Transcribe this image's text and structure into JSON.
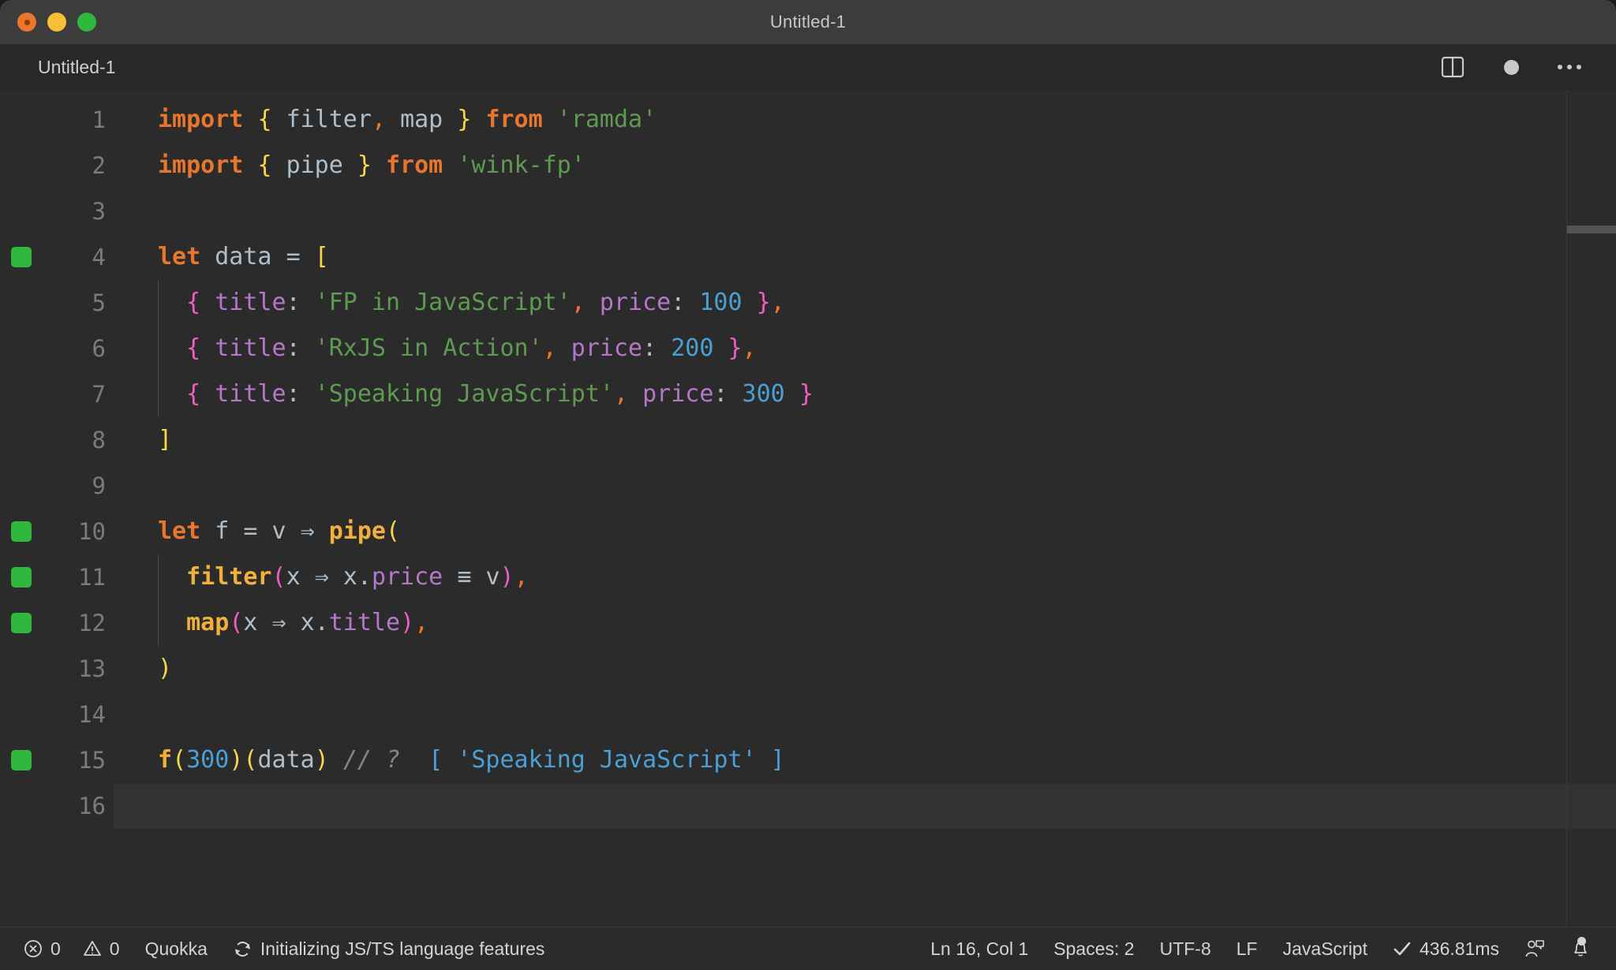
{
  "window": {
    "title": "Untitled-1",
    "traffic_lights": [
      "close-button",
      "minimize-button",
      "maximize-button"
    ]
  },
  "tab": {
    "label": "Untitled-1"
  },
  "editor_actions": {
    "split_editor": "split-editor-icon",
    "unsaved_dot": "unsaved-indicator",
    "more": "more-actions-icon"
  },
  "editor": {
    "language": "JavaScript",
    "lines": [
      {
        "no": "1",
        "marked": false,
        "indent": false,
        "tokens": [
          {
            "t": "import",
            "c": "t-kw"
          },
          {
            "t": " ",
            "c": "t-plain"
          },
          {
            "t": "{",
            "c": "t-brace"
          },
          {
            "t": " ",
            "c": "t-plain"
          },
          {
            "t": "filter",
            "c": "t-id"
          },
          {
            "t": ",",
            "c": "t-punct"
          },
          {
            "t": " ",
            "c": "t-plain"
          },
          {
            "t": "map",
            "c": "t-id"
          },
          {
            "t": " ",
            "c": "t-plain"
          },
          {
            "t": "}",
            "c": "t-brace"
          },
          {
            "t": " ",
            "c": "t-plain"
          },
          {
            "t": "from",
            "c": "t-kw"
          },
          {
            "t": " ",
            "c": "t-plain"
          },
          {
            "t": "'ramda'",
            "c": "t-str"
          }
        ]
      },
      {
        "no": "2",
        "marked": false,
        "indent": false,
        "tokens": [
          {
            "t": "import",
            "c": "t-kw"
          },
          {
            "t": " ",
            "c": "t-plain"
          },
          {
            "t": "{",
            "c": "t-brace"
          },
          {
            "t": " ",
            "c": "t-plain"
          },
          {
            "t": "pipe",
            "c": "t-id"
          },
          {
            "t": " ",
            "c": "t-plain"
          },
          {
            "t": "}",
            "c": "t-brace"
          },
          {
            "t": " ",
            "c": "t-plain"
          },
          {
            "t": "from",
            "c": "t-kw"
          },
          {
            "t": " ",
            "c": "t-plain"
          },
          {
            "t": "'wink-fp'",
            "c": "t-str"
          }
        ]
      },
      {
        "no": "3",
        "marked": false,
        "indent": false,
        "tokens": []
      },
      {
        "no": "4",
        "marked": true,
        "indent": false,
        "tokens": [
          {
            "t": "let",
            "c": "t-kw"
          },
          {
            "t": " ",
            "c": "t-plain"
          },
          {
            "t": "data",
            "c": "t-id"
          },
          {
            "t": " ",
            "c": "t-plain"
          },
          {
            "t": "=",
            "c": "t-op"
          },
          {
            "t": " ",
            "c": "t-plain"
          },
          {
            "t": "[",
            "c": "t-brace"
          }
        ]
      },
      {
        "no": "5",
        "marked": false,
        "indent": true,
        "tokens": [
          {
            "t": "  ",
            "c": "t-plain"
          },
          {
            "t": "{",
            "c": "t-brace2"
          },
          {
            "t": " ",
            "c": "t-plain"
          },
          {
            "t": "title",
            "c": "t-prop"
          },
          {
            "t": ":",
            "c": "t-id"
          },
          {
            "t": " ",
            "c": "t-plain"
          },
          {
            "t": "'FP in JavaScript'",
            "c": "t-str"
          },
          {
            "t": ",",
            "c": "t-punct"
          },
          {
            "t": " ",
            "c": "t-plain"
          },
          {
            "t": "price",
            "c": "t-prop"
          },
          {
            "t": ":",
            "c": "t-id"
          },
          {
            "t": " ",
            "c": "t-plain"
          },
          {
            "t": "100",
            "c": "t-num"
          },
          {
            "t": " ",
            "c": "t-plain"
          },
          {
            "t": "}",
            "c": "t-brace2"
          },
          {
            "t": ",",
            "c": "t-punct"
          }
        ]
      },
      {
        "no": "6",
        "marked": false,
        "indent": true,
        "tokens": [
          {
            "t": "  ",
            "c": "t-plain"
          },
          {
            "t": "{",
            "c": "t-brace2"
          },
          {
            "t": " ",
            "c": "t-plain"
          },
          {
            "t": "title",
            "c": "t-prop"
          },
          {
            "t": ":",
            "c": "t-id"
          },
          {
            "t": " ",
            "c": "t-plain"
          },
          {
            "t": "'RxJS in Action'",
            "c": "t-str"
          },
          {
            "t": ",",
            "c": "t-punct"
          },
          {
            "t": " ",
            "c": "t-plain"
          },
          {
            "t": "price",
            "c": "t-prop"
          },
          {
            "t": ":",
            "c": "t-id"
          },
          {
            "t": " ",
            "c": "t-plain"
          },
          {
            "t": "200",
            "c": "t-num"
          },
          {
            "t": " ",
            "c": "t-plain"
          },
          {
            "t": "}",
            "c": "t-brace2"
          },
          {
            "t": ",",
            "c": "t-punct"
          }
        ]
      },
      {
        "no": "7",
        "marked": false,
        "indent": true,
        "tokens": [
          {
            "t": "  ",
            "c": "t-plain"
          },
          {
            "t": "{",
            "c": "t-brace2"
          },
          {
            "t": " ",
            "c": "t-plain"
          },
          {
            "t": "title",
            "c": "t-prop"
          },
          {
            "t": ":",
            "c": "t-id"
          },
          {
            "t": " ",
            "c": "t-plain"
          },
          {
            "t": "'Speaking JavaScript'",
            "c": "t-str"
          },
          {
            "t": ",",
            "c": "t-punct"
          },
          {
            "t": " ",
            "c": "t-plain"
          },
          {
            "t": "price",
            "c": "t-prop"
          },
          {
            "t": ":",
            "c": "t-id"
          },
          {
            "t": " ",
            "c": "t-plain"
          },
          {
            "t": "300",
            "c": "t-num"
          },
          {
            "t": " ",
            "c": "t-plain"
          },
          {
            "t": "}",
            "c": "t-brace2"
          }
        ]
      },
      {
        "no": "8",
        "marked": false,
        "indent": false,
        "tokens": [
          {
            "t": "]",
            "c": "t-brace"
          }
        ]
      },
      {
        "no": "9",
        "marked": false,
        "indent": false,
        "tokens": []
      },
      {
        "no": "10",
        "marked": true,
        "indent": false,
        "tokens": [
          {
            "t": "let",
            "c": "t-kw"
          },
          {
            "t": " ",
            "c": "t-plain"
          },
          {
            "t": "f",
            "c": "t-id"
          },
          {
            "t": " ",
            "c": "t-plain"
          },
          {
            "t": "=",
            "c": "t-op"
          },
          {
            "t": " ",
            "c": "t-plain"
          },
          {
            "t": "v",
            "c": "t-id"
          },
          {
            "t": " ",
            "c": "t-plain"
          },
          {
            "t": "⇒",
            "c": "t-op"
          },
          {
            "t": " ",
            "c": "t-plain"
          },
          {
            "t": "pipe",
            "c": "t-fn"
          },
          {
            "t": "(",
            "c": "t-brace"
          }
        ]
      },
      {
        "no": "11",
        "marked": true,
        "indent": true,
        "tokens": [
          {
            "t": "  ",
            "c": "t-plain"
          },
          {
            "t": "filter",
            "c": "t-fn"
          },
          {
            "t": "(",
            "c": "t-brace2"
          },
          {
            "t": "x",
            "c": "t-id"
          },
          {
            "t": " ",
            "c": "t-plain"
          },
          {
            "t": "⇒",
            "c": "t-op"
          },
          {
            "t": " ",
            "c": "t-plain"
          },
          {
            "t": "x",
            "c": "t-id"
          },
          {
            "t": ".",
            "c": "t-id"
          },
          {
            "t": "price",
            "c": "t-prop"
          },
          {
            "t": " ",
            "c": "t-plain"
          },
          {
            "t": "≡",
            "c": "t-op"
          },
          {
            "t": " ",
            "c": "t-plain"
          },
          {
            "t": "v",
            "c": "t-id"
          },
          {
            "t": ")",
            "c": "t-brace2"
          },
          {
            "t": ",",
            "c": "t-punct"
          }
        ]
      },
      {
        "no": "12",
        "marked": true,
        "indent": true,
        "tokens": [
          {
            "t": "  ",
            "c": "t-plain"
          },
          {
            "t": "map",
            "c": "t-fn"
          },
          {
            "t": "(",
            "c": "t-brace2"
          },
          {
            "t": "x",
            "c": "t-id"
          },
          {
            "t": " ",
            "c": "t-plain"
          },
          {
            "t": "⇒",
            "c": "t-op"
          },
          {
            "t": " ",
            "c": "t-plain"
          },
          {
            "t": "x",
            "c": "t-id"
          },
          {
            "t": ".",
            "c": "t-id"
          },
          {
            "t": "title",
            "c": "t-prop"
          },
          {
            "t": ")",
            "c": "t-brace2"
          },
          {
            "t": ",",
            "c": "t-punct"
          }
        ]
      },
      {
        "no": "13",
        "marked": false,
        "indent": false,
        "tokens": [
          {
            "t": ")",
            "c": "t-brace"
          }
        ]
      },
      {
        "no": "14",
        "marked": false,
        "indent": false,
        "tokens": []
      },
      {
        "no": "15",
        "marked": true,
        "indent": false,
        "tokens": [
          {
            "t": "f",
            "c": "t-fn"
          },
          {
            "t": "(",
            "c": "t-brace"
          },
          {
            "t": "300",
            "c": "t-num"
          },
          {
            "t": ")",
            "c": "t-brace"
          },
          {
            "t": "(",
            "c": "t-brace"
          },
          {
            "t": "data",
            "c": "t-id"
          },
          {
            "t": ")",
            "c": "t-brace"
          },
          {
            "t": " ",
            "c": "t-plain"
          },
          {
            "t": "// ?",
            "c": "t-comment"
          },
          {
            "t": "  ",
            "c": "t-plain"
          },
          {
            "t": "[ 'Speaking JavaScript' ]",
            "c": "t-result"
          }
        ]
      },
      {
        "no": "16",
        "marked": false,
        "indent": false,
        "current": true,
        "tokens": []
      }
    ]
  },
  "statusbar": {
    "errors": "0",
    "warnings": "0",
    "quokka": "Quokka",
    "task": "Initializing JS/TS language features",
    "cursor": "Ln 16, Col 1",
    "indent": "Spaces: 2",
    "encoding": "UTF-8",
    "eol": "LF",
    "language": "JavaScript",
    "timing": "436.81ms",
    "icons": {
      "error": "error-circle-icon",
      "warning": "warning-triangle-icon",
      "sync": "sync-spinner-icon",
      "check": "checkmark-icon",
      "feedback": "feedback-person-icon",
      "bell": "notifications-bell-icon"
    }
  },
  "colors": {
    "accent_green": "#2fb83d",
    "keyword": "#e8762c",
    "string": "#5f9a52",
    "number": "#4a9fd4",
    "property": "#b577c9",
    "function": "#f0b03a",
    "brace_yellow": "#f8d74a",
    "brace_magenta": "#ef5ec0",
    "background": "#2b2b2b"
  }
}
